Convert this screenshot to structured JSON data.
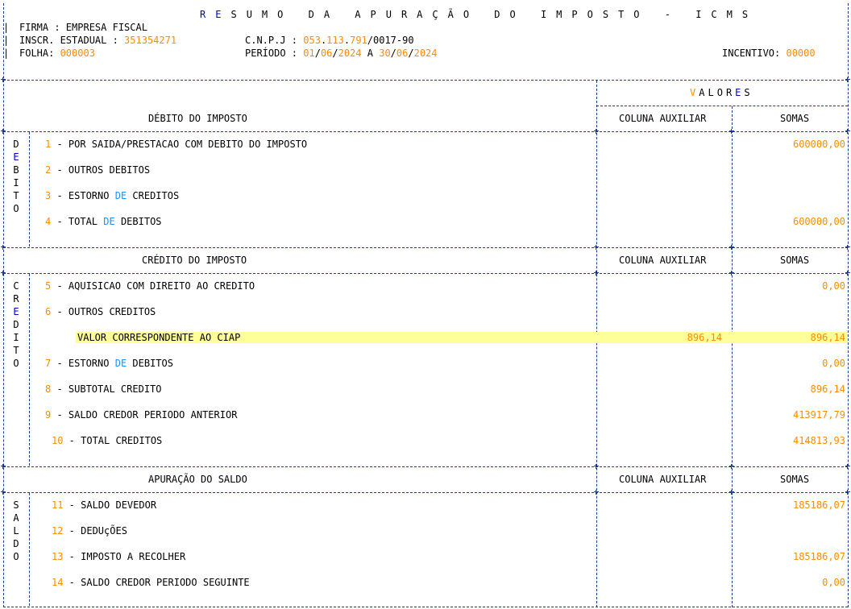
{
  "header": {
    "title_parts": [
      "R",
      "E",
      "SUMO DA APURAÇÃO DO IMPOSTO - ICMS"
    ],
    "firma_label": "FIRMA : EMPRESA FISCAL",
    "inscr_label": "INSCR. ESTADUAL : ",
    "inscr_value": "351354271",
    "cnpj_label": "C.N.P.J : ",
    "cnpj_a": "053",
    "cnpj_b": ".",
    "cnpj_c": "113",
    "cnpj_d": ".",
    "cnpj_e": "791",
    "cnpj_f": "/0017-90",
    "folha_label": "FOLHA: ",
    "folha_value": "000003",
    "periodo_label": "PERÍODO : ",
    "periodo_d1": "01",
    "periodo_m1": "06",
    "periodo_y1": "2024",
    "periodo_a": " A ",
    "periodo_d2": "30",
    "periodo_m2": "06",
    "periodo_y2": "2024",
    "incentivo_label": "INCENTIVO: ",
    "incentivo_value": "00000"
  },
  "valores": {
    "v": "V",
    "a": "A",
    "l": "L",
    "o": "O",
    "r": "R",
    "e": "E",
    "s": "S"
  },
  "columns": {
    "aux": "COLUNA AUXILIAR",
    "somas": "SOMAS"
  },
  "debito": {
    "section_title": "DÉBITO DO IMPOSTO",
    "side_letters": [
      "D",
      "E",
      "B",
      "I",
      "T",
      "O"
    ],
    "rows": [
      {
        "num": "1",
        "text": " - POR SAIDA/PRESTACAO COM DEBITO DO IMPOSTO",
        "somas": "600000,00"
      },
      {
        "num": "2",
        "text": " - OUTROS DEBITOS",
        "somas": ""
      },
      {
        "num": "3",
        "text_a": " - ESTORNO ",
        "text_de": "DE",
        "text_b": " CREDITOS",
        "somas": ""
      },
      {
        "num": "4",
        "text_a": " - TOTAL ",
        "text_de": "DE",
        "text_b": " DEBITOS",
        "somas": "600000,00"
      }
    ]
  },
  "credito": {
    "section_title": "CRÉDITO DO IMPOSTO",
    "side_letters": [
      "C",
      "R",
      "E",
      "D",
      "I",
      "T",
      "O"
    ],
    "rows": [
      {
        "num": "5",
        "text": " - AQUISICAO COM DIREITO AO CREDITO",
        "somas": "0,00"
      },
      {
        "num": "6",
        "text": " - OUTROS CREDITOS",
        "somas": ""
      },
      {
        "text": "VALOR CORRESPONDENTE AO CIAP",
        "aux": "896,14",
        "somas": "896,14"
      },
      {
        "num": "7",
        "text_a": " - ESTORNO ",
        "text_de": "DE",
        "text_b": " DEBITOS",
        "somas": "0,00"
      },
      {
        "num": "8",
        "text": " - SUBTOTAL CREDITO",
        "somas": "896,14"
      },
      {
        "num": "9",
        "text": " - SALDO CREDOR PERIODO ANTERIOR",
        "somas": "413917,79"
      },
      {
        "num": "10",
        "text": " - TOTAL CREDITOS",
        "somas": "414813,93"
      }
    ]
  },
  "saldo": {
    "section_title": "APURAÇÃO DO SALDO",
    "side_letters": [
      "S",
      "A",
      "L",
      "D",
      "O"
    ],
    "rows": [
      {
        "num": "11",
        "text": " - SALDO DEVEDOR",
        "somas": "185186,07"
      },
      {
        "num": "12",
        "text": " - DEDUçÕES",
        "somas": ""
      },
      {
        "num": "13",
        "text": " - IMPOSTO A RECOLHER",
        "somas": "185186,07"
      },
      {
        "num": "14",
        "text": " - SALDO CREDOR PERIODO SEGUINTE",
        "somas": "0,00"
      }
    ]
  },
  "colors": {
    "accent_orange": "#ff8c00",
    "accent_blue": "#0000c0",
    "accent_lightblue": "#1e90ff",
    "highlight": "#ffff99",
    "rule": "#1a3a8a"
  }
}
